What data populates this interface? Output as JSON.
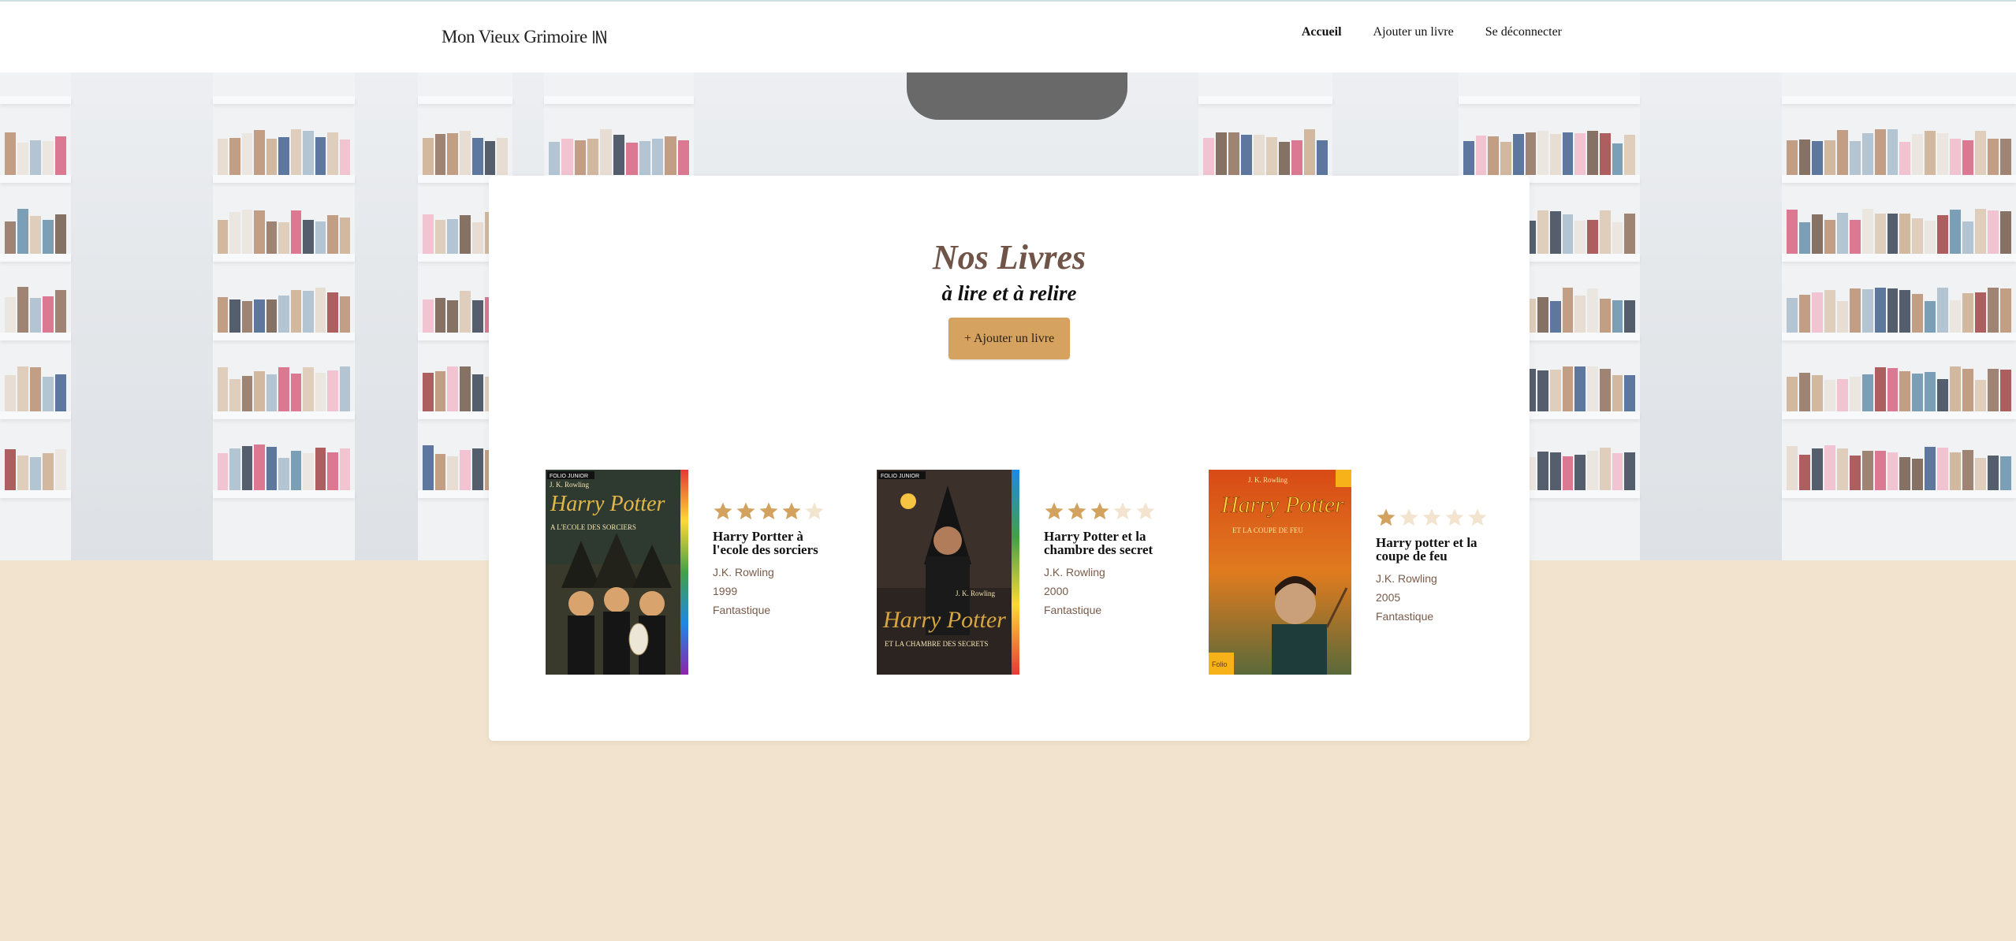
{
  "header": {
    "logo_text": "Mon Vieux Grimoire",
    "logo_icon": "book-logo-icon",
    "nav": [
      {
        "label": "Accueil",
        "active": true
      },
      {
        "label": "Ajouter un livre",
        "active": false
      },
      {
        "label": "Se déconnecter",
        "active": false
      }
    ]
  },
  "main": {
    "title": "Nos Livres",
    "subtitle": "à lire et à relire",
    "add_button_label": "+ Ajouter un livre"
  },
  "books": [
    {
      "title": "Harry Portter à l'ecole des sorciers",
      "author": "J.K. Rowling",
      "year": "1999",
      "genre": "Fantastique",
      "rating": 4,
      "max_rating": 5,
      "cover": {
        "series": "Harry Potter",
        "subtitle": "A L'ECOLE DES SORCIERS",
        "author": "J. K. Rowling",
        "collection": "FOLIO JUNIOR"
      }
    },
    {
      "title": "Harry Potter et la chambre des secret",
      "author": "J.K. Rowling",
      "year": "2000",
      "genre": "Fantastique",
      "rating": 3,
      "max_rating": 5,
      "cover": {
        "series": "Harry Potter",
        "subtitle": "ET LA CHAMBRE DES SECRETS",
        "author": "J. K. Rowling",
        "collection": "FOLIO JUNIOR"
      }
    },
    {
      "title": "Harry potter et la coupe de feu",
      "author": "J.K. Rowling",
      "year": "2005",
      "genre": "Fantastique",
      "rating": 1,
      "max_rating": 5,
      "cover": {
        "series": "Harry Potter",
        "subtitle": "ET LA COUPE DE FEU",
        "author": "J. K. Rowling",
        "collection": "Folio"
      }
    }
  ],
  "colors": {
    "accent": "#d5a35f",
    "star_filled": "#d3a25f",
    "star_empty": "#f2e4cf",
    "page_background": "#f1e3cd",
    "title_color": "#6f5447",
    "meta_color": "#7a5b4a"
  }
}
